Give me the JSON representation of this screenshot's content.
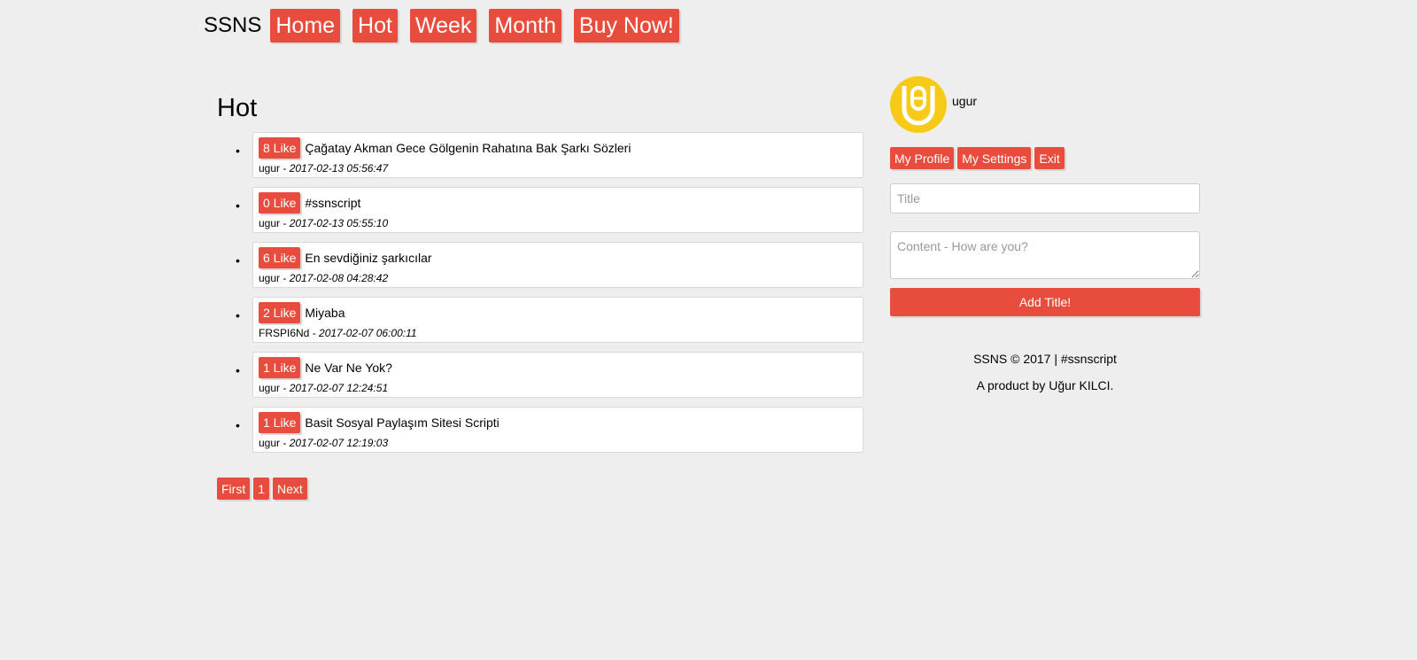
{
  "header": {
    "brand": "SSNS",
    "nav": [
      "Home",
      "Hot",
      "Week",
      "Month",
      "Buy Now!"
    ]
  },
  "main": {
    "title": "Hot",
    "posts": [
      {
        "likes": "8 Like",
        "title": "Çağatay Akman Gece Gölgenin Rahatına Bak Şarkı Sözleri",
        "author": "ugur",
        "date": "2017-02-13 05:56:47"
      },
      {
        "likes": "0 Like",
        "title": "#ssnscript",
        "author": "ugur",
        "date": "2017-02-13 05:55:10"
      },
      {
        "likes": "6 Like",
        "title": "En sevdiğiniz şarkıcılar",
        "author": "ugur",
        "date": "2017-02-08 04:28:42"
      },
      {
        "likes": "2 Like",
        "title": "Miyaba",
        "author": "FRSPI6Nd",
        "date": "2017-02-07 06:00:11"
      },
      {
        "likes": "1 Like",
        "title": "Ne Var Ne Yok?",
        "author": "ugur",
        "date": "2017-02-07 12:24:51"
      },
      {
        "likes": "1 Like",
        "title": "Basit Sosyal Paylaşım Sitesi Scripti",
        "author": "ugur",
        "date": "2017-02-07 12:19:03"
      }
    ],
    "pager": [
      "First",
      "1",
      "Next"
    ]
  },
  "sidebar": {
    "username": "ugur",
    "account_buttons": [
      "My Profile",
      "My Settings",
      "Exit"
    ],
    "title_placeholder": "Title",
    "content_placeholder": "Content - How are you?",
    "submit_label": "Add Title!",
    "footer_line1": "SSNS © 2017 | #ssnscript",
    "footer_line2": "A product by Uğur KILCI."
  },
  "colors": {
    "accent": "#e74c3c",
    "background": "#eeeeee",
    "avatar": "#f7ca18"
  }
}
